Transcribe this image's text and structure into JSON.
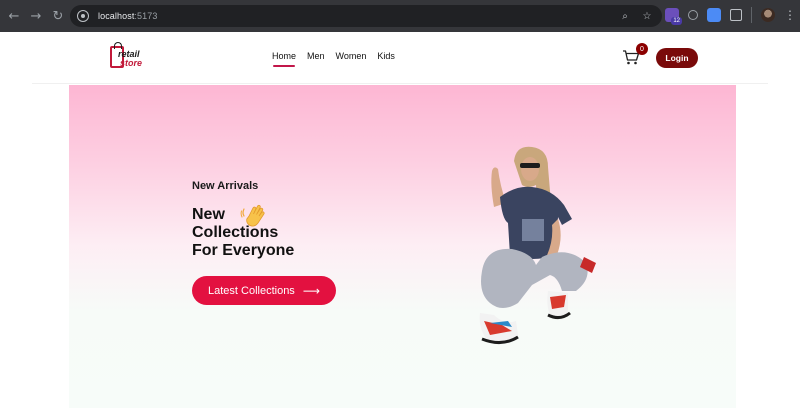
{
  "browser": {
    "back_icon": "arrow-left-icon",
    "forward_icon": "arrow-right-icon",
    "reload_icon": "reload-icon",
    "url_host": "localhost",
    "url_port": ":5173",
    "zoom_icon": "zoom-icon",
    "bookmark_icon": "star-icon",
    "extension_badge": "12"
  },
  "site": {
    "logo_top": "retail",
    "logo_bottom": "store",
    "nav": [
      {
        "label": "Home",
        "active": true
      },
      {
        "label": "Men",
        "active": false
      },
      {
        "label": "Women",
        "active": false
      },
      {
        "label": "Kids",
        "active": false
      }
    ],
    "cart_count": "0",
    "login_label": "Login"
  },
  "hero": {
    "eyebrow": "New Arrivals",
    "headline_1": "New",
    "headline_2": "Collections",
    "headline_3": "For Everyone",
    "cta_label": "Latest Collections",
    "cta_icon": "arrow-right-icon",
    "wave_icon": "waving-hand-icon"
  },
  "colors": {
    "brand_red": "#e31140",
    "login_bg": "#7a0a0a",
    "cart_badge": "#8b0000",
    "hero_top": "#fdb6d3",
    "hero_bottom": "#f7fcf9"
  }
}
